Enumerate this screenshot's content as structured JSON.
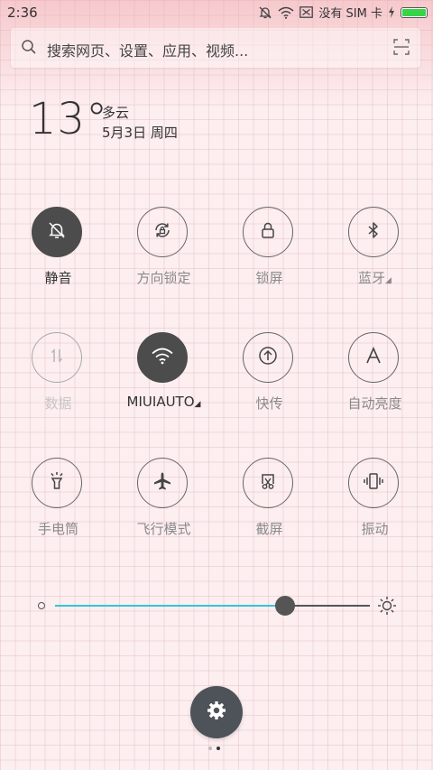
{
  "status_bar": {
    "time": "2:36",
    "sim_text": "没有 SIM 卡",
    "battery_level": 1.0,
    "battery_color": "#37d447"
  },
  "search": {
    "placeholder": "搜索网页、设置、应用、视频...",
    "icon": "search-icon",
    "scan_icon": "scan-icon"
  },
  "weather": {
    "temperature": "13°",
    "condition": "多云",
    "date": "5月3日 周四"
  },
  "toggles": [
    {
      "label": "静音",
      "icon": "bell-off-icon",
      "state": "on"
    },
    {
      "label": "方向锁定",
      "icon": "rotation-lock-icon",
      "state": "off"
    },
    {
      "label": "锁屏",
      "icon": "lock-icon",
      "state": "off"
    },
    {
      "label": "蓝牙",
      "icon": "bluetooth-icon",
      "state": "off",
      "has_more": true
    },
    {
      "label": "数据",
      "icon": "mobile-data-icon",
      "state": "disabled"
    },
    {
      "label": "MIUIAUTO",
      "icon": "wifi-icon",
      "state": "on",
      "has_more": true
    },
    {
      "label": "快传",
      "icon": "quick-transfer-icon",
      "state": "off"
    },
    {
      "label": "自动亮度",
      "icon": "auto-brightness-icon",
      "state": "off"
    },
    {
      "label": "手电筒",
      "icon": "flashlight-icon",
      "state": "off"
    },
    {
      "label": "飞行模式",
      "icon": "airplane-icon",
      "state": "off"
    },
    {
      "label": "截屏",
      "icon": "screenshot-icon",
      "state": "off"
    },
    {
      "label": "振动",
      "icon": "vibrate-icon",
      "state": "off"
    }
  ],
  "more_arrow": "◢",
  "brightness": {
    "level": 0.73,
    "fill_color": "#36c4d6"
  },
  "settings_icon": "gear-icon",
  "pages": {
    "count": 2,
    "active": 2
  }
}
